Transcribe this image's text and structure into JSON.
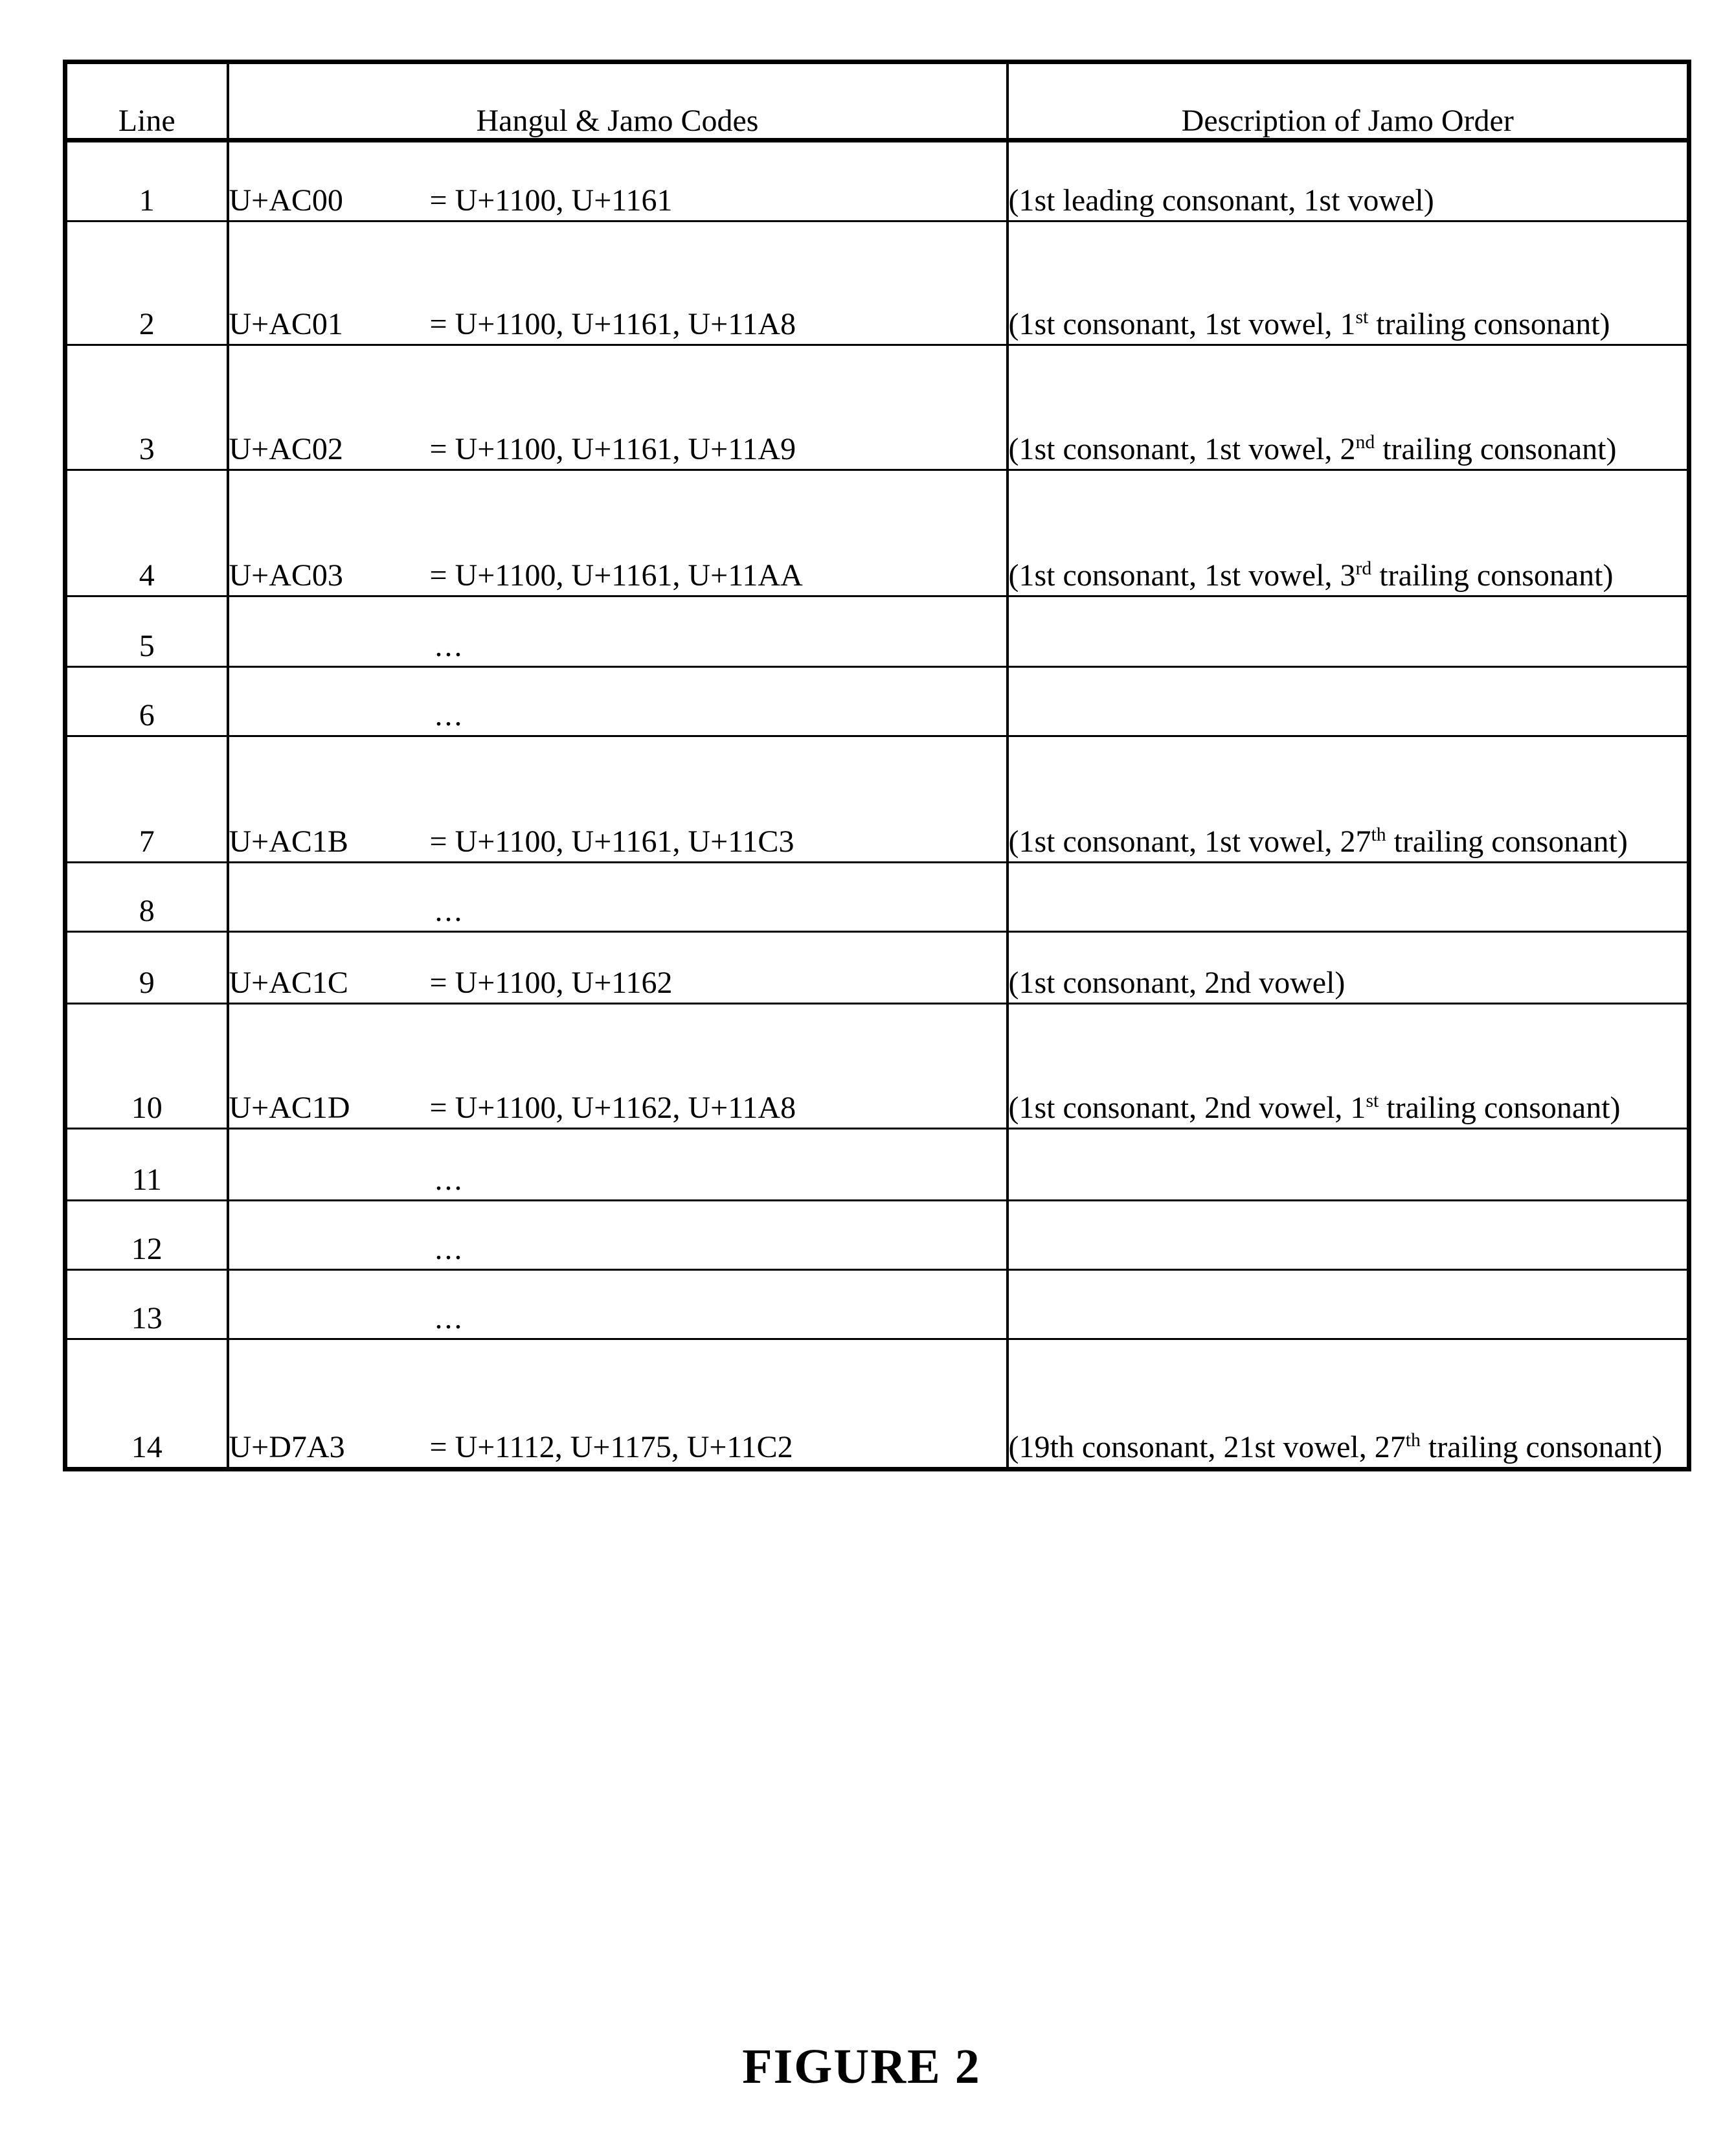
{
  "figure": {
    "caption": "FIGURE 2"
  },
  "table": {
    "headers": {
      "line": "Line",
      "codes": "Hangul & Jamo Codes",
      "description": "Description of Jamo Order"
    },
    "ellipsis": "...",
    "rows": [
      {
        "line": "1",
        "code_point": "U+AC00",
        "decomposition": "= U+1100, U+1161",
        "desc_pre": "(1st leading consonant, 1st vowel)",
        "desc_sup": "",
        "desc_post": "",
        "is_ellipsis": false
      },
      {
        "line": "2",
        "code_point": "U+AC01",
        "decomposition": "= U+1100, U+1161, U+11A8",
        "desc_pre": "(1st consonant, 1st vowel, 1",
        "desc_sup": "st",
        "desc_post": " trailing consonant)",
        "is_ellipsis": false
      },
      {
        "line": "3",
        "code_point": "U+AC02",
        "decomposition": "= U+1100, U+1161, U+11A9",
        "desc_pre": "(1st consonant, 1st vowel, 2",
        "desc_sup": "nd",
        "desc_post": " trailing consonant)",
        "is_ellipsis": false
      },
      {
        "line": "4",
        "code_point": "U+AC03",
        "decomposition": "= U+1100, U+1161, U+11AA",
        "desc_pre": "(1st consonant, 1st vowel, 3",
        "desc_sup": "rd",
        "desc_post": " trailing consonant)",
        "is_ellipsis": false
      },
      {
        "line": "5",
        "code_point": "",
        "decomposition": "",
        "desc_pre": "",
        "desc_sup": "",
        "desc_post": "",
        "is_ellipsis": true
      },
      {
        "line": "6",
        "code_point": "",
        "decomposition": "",
        "desc_pre": "",
        "desc_sup": "",
        "desc_post": "",
        "is_ellipsis": true
      },
      {
        "line": "7",
        "code_point": "U+AC1B",
        "decomposition": "= U+1100, U+1161, U+11C3",
        "desc_pre": "(1st consonant, 1st vowel, 27",
        "desc_sup": "th",
        "desc_post": " trailing consonant)",
        "is_ellipsis": false
      },
      {
        "line": "8",
        "code_point": "",
        "decomposition": "",
        "desc_pre": "",
        "desc_sup": "",
        "desc_post": "",
        "is_ellipsis": true
      },
      {
        "line": "9",
        "code_point": "U+AC1C",
        "decomposition": "= U+1100, U+1162",
        "desc_pre": "(1st consonant, 2nd vowel)",
        "desc_sup": "",
        "desc_post": "",
        "is_ellipsis": false
      },
      {
        "line": "10",
        "code_point": "U+AC1D",
        "decomposition": "= U+1100, U+1162, U+11A8",
        "desc_pre": "(1st consonant, 2nd vowel, 1",
        "desc_sup": "st",
        "desc_post": " trailing consonant)",
        "is_ellipsis": false
      },
      {
        "line": "11",
        "code_point": "",
        "decomposition": "",
        "desc_pre": "",
        "desc_sup": "",
        "desc_post": "",
        "is_ellipsis": true
      },
      {
        "line": "12",
        "code_point": "",
        "decomposition": "",
        "desc_pre": "",
        "desc_sup": "",
        "desc_post": "",
        "is_ellipsis": true
      },
      {
        "line": "13",
        "code_point": "",
        "decomposition": "",
        "desc_pre": "",
        "desc_sup": "",
        "desc_post": "",
        "is_ellipsis": true
      },
      {
        "line": "14",
        "code_point": "U+D7A3",
        "decomposition": "= U+1112, U+1175, U+11C2",
        "desc_pre": "(19th consonant, 21st vowel, 27",
        "desc_sup": "th",
        "desc_post": " trailing consonant)",
        "is_ellipsis": false
      }
    ]
  }
}
